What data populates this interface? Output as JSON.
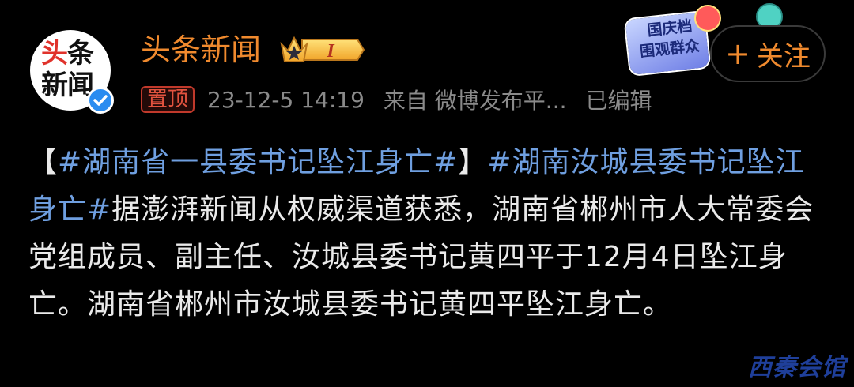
{
  "avatar": {
    "line1_a": "头",
    "line1_b": "条",
    "line2": "新闻"
  },
  "header": {
    "username": "头条新闻",
    "level_badge": "I"
  },
  "meta": {
    "pin_label": "置顶",
    "timestamp": "23-12-5 14:19",
    "source": "来自 微博发布平...",
    "edited": "已编辑"
  },
  "follow": {
    "plus": "+",
    "label": "关注"
  },
  "promo": {
    "line1": "国庆档",
    "line2": "围观群众"
  },
  "post": {
    "open_bracket": "【",
    "hashtag1": "#湖南省一县委书记坠江身亡#",
    "close_bracket": "】",
    "hashtag2": "#湖南汝城县委书记坠江身亡#",
    "body": "据澎湃新闻从权威渠道获悉，湖南省郴州市人大常委会党组成员、副主任、汝城县委书记黄四平于12月4日坠江身亡。湖南省郴州市汝城县委书记黄四平坠江身亡。"
  },
  "watermark": "西秦会馆",
  "colors": {
    "background": "#000000",
    "username": "#f08a2e",
    "hashtag": "#6f9fe0",
    "body_text": "#eaeaea",
    "meta_text": "#8a8a8a",
    "verified": "#2a8cf0"
  }
}
